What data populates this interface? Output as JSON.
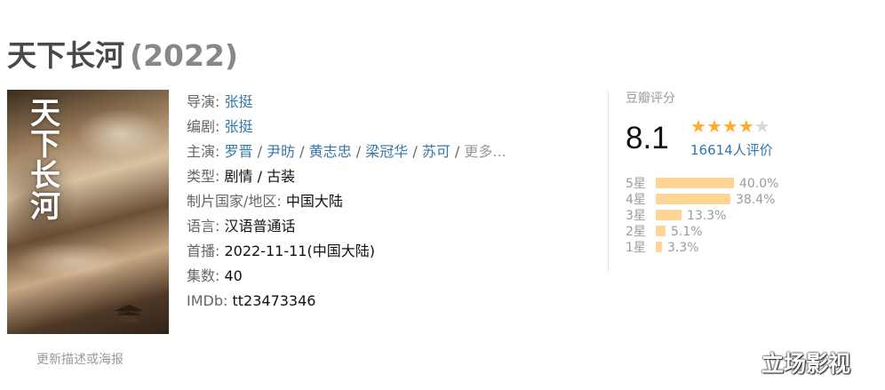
{
  "title": "天下长河",
  "year": "(2022)",
  "poster": {
    "title_text": "天下长河",
    "update_link": "更新描述或海报"
  },
  "info": {
    "director_label": "导演",
    "director": "张挺",
    "writer_label": "编剧",
    "writer": "张挺",
    "cast_label": "主演",
    "cast": [
      "罗晋",
      "尹昉",
      "黄志忠",
      "梁冠华",
      "苏可"
    ],
    "cast_more": "更多...",
    "genre_label": "类型",
    "genre": "剧情 / 古装",
    "country_label": "制片国家/地区",
    "country": "中国大陆",
    "language_label": "语言",
    "language": "汉语普通话",
    "premiere_label": "首播",
    "premiere": "2022-11-11(中国大陆)",
    "episodes_label": "集数",
    "episodes": "40",
    "imdb_label": "IMDb",
    "imdb": "tt23473346"
  },
  "rating": {
    "label": "豆瓣评分",
    "score": "8.1",
    "stars": 4,
    "stars_max": 5,
    "count": "16614人评价",
    "distribution": [
      {
        "label": "5星",
        "percent": 40.0,
        "text": "40.0%"
      },
      {
        "label": "4星",
        "percent": 38.4,
        "text": "38.4%"
      },
      {
        "label": "3星",
        "percent": 13.3,
        "text": "13.3%"
      },
      {
        "label": "2星",
        "percent": 5.1,
        "text": "5.1%"
      },
      {
        "label": "1星",
        "percent": 3.3,
        "text": "3.3%"
      }
    ]
  },
  "watermark": "立场影视",
  "colors": {
    "link": "#3377aa",
    "star": "#ffac2d",
    "bar": "#ffd596",
    "label": "#666666"
  }
}
